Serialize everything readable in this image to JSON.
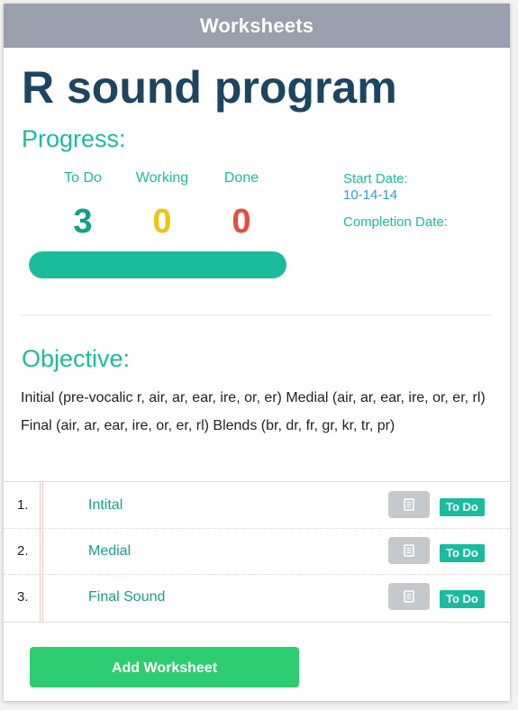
{
  "header": {
    "title": "Worksheets"
  },
  "program": {
    "title": "R sound program"
  },
  "progress": {
    "heading": "Progress:",
    "stats": [
      {
        "label": "To Do",
        "value": "3",
        "color": "#16a085"
      },
      {
        "label": "Working",
        "value": "0",
        "color": "#f1c40f"
      },
      {
        "label": "Done",
        "value": "0",
        "color": "#e74c3c"
      }
    ],
    "bar_fraction": 1.0,
    "start_label": "Start Date:",
    "start_value": "10-14-14",
    "completion_label": "Completion Date:"
  },
  "objective": {
    "heading": "Objective:",
    "text": "Initial (pre-vocalic r, air, ar, ear, ire, or, er) Medial (air, ar, ear, ire, or, er, rl) Final (air, ar, ear, ire, or, er, rl) Blends (br, dr, fr, gr, kr, tr, pr)"
  },
  "worksheets": [
    {
      "num": "1.",
      "name": "Intital",
      "status": "To Do",
      "icon": "document-icon"
    },
    {
      "num": "2.",
      "name": "Medial",
      "status": "To Do",
      "icon": "document-icon"
    },
    {
      "num": "3.",
      "name": "Final Sound",
      "status": "To Do",
      "icon": "document-icon"
    }
  ],
  "actions": {
    "add_label": "Add Worksheet"
  },
  "colors": {
    "accent": "#1abc9c",
    "header_bg": "#9a9fad",
    "title": "#1e4560",
    "button_green": "#2ecc71"
  }
}
